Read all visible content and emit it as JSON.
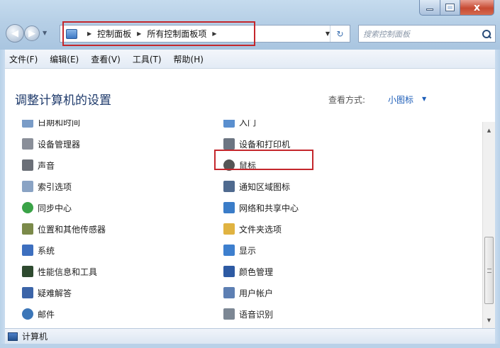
{
  "window": {
    "close_glyph": "x"
  },
  "address": {
    "breadcrumbs": [
      "控制面板",
      "所有控制面板项"
    ]
  },
  "search": {
    "placeholder": "搜索控制面板"
  },
  "menu": [
    "文件(F)",
    "编辑(E)",
    "查看(V)",
    "工具(T)",
    "帮助(H)"
  ],
  "header": {
    "title": "调整计算机的设置",
    "view_by_label": "查看方式:",
    "view_by_value": "小图标"
  },
  "items_left": [
    {
      "label": "日期和时间",
      "icon": "clock-icon",
      "color": "#7a9cc7"
    },
    {
      "label": "设备管理器",
      "icon": "device-manager-icon",
      "color": "#8a8f99"
    },
    {
      "label": "声音",
      "icon": "speaker-icon",
      "color": "#6b6f77"
    },
    {
      "label": "索引选项",
      "icon": "index-icon",
      "color": "#8aa3c4"
    },
    {
      "label": "同步中心",
      "icon": "sync-icon",
      "color": "#3aa347"
    },
    {
      "label": "位置和其他传感器",
      "icon": "sensor-icon",
      "color": "#7b8a4a"
    },
    {
      "label": "系统",
      "icon": "system-icon",
      "color": "#3d6fbf"
    },
    {
      "label": "性能信息和工具",
      "icon": "performance-icon",
      "color": "#2e4a2f"
    },
    {
      "label": "疑难解答",
      "icon": "troubleshoot-icon",
      "color": "#3b64a8"
    },
    {
      "label": "邮件",
      "icon": "mail-icon",
      "color": "#3c76b8"
    }
  ],
  "items_right": [
    {
      "label": "入门",
      "icon": "getting-started-icon",
      "color": "#5a8fcf"
    },
    {
      "label": "设备和打印机",
      "icon": "printer-icon",
      "color": "#6c7582"
    },
    {
      "label": "鼠标",
      "icon": "mouse-icon",
      "color": "#555555"
    },
    {
      "label": "通知区域图标",
      "icon": "notification-icon",
      "color": "#4f6a8f"
    },
    {
      "label": "网络和共享中心",
      "icon": "network-icon",
      "color": "#3a7cc8"
    },
    {
      "label": "文件夹选项",
      "icon": "folder-icon",
      "color": "#e0b341"
    },
    {
      "label": "显示",
      "icon": "display-icon",
      "color": "#3d7fce"
    },
    {
      "label": "颜色管理",
      "icon": "color-management-icon",
      "color": "#2d5aa3"
    },
    {
      "label": "用户帐户",
      "icon": "user-accounts-icon",
      "color": "#5d7fb3"
    },
    {
      "label": "语音识别",
      "icon": "microphone-icon",
      "color": "#7c8794"
    }
  ],
  "status": {
    "text": "计算机"
  },
  "colors": {
    "highlight": "#c4272c",
    "link": "#1c5db8"
  }
}
